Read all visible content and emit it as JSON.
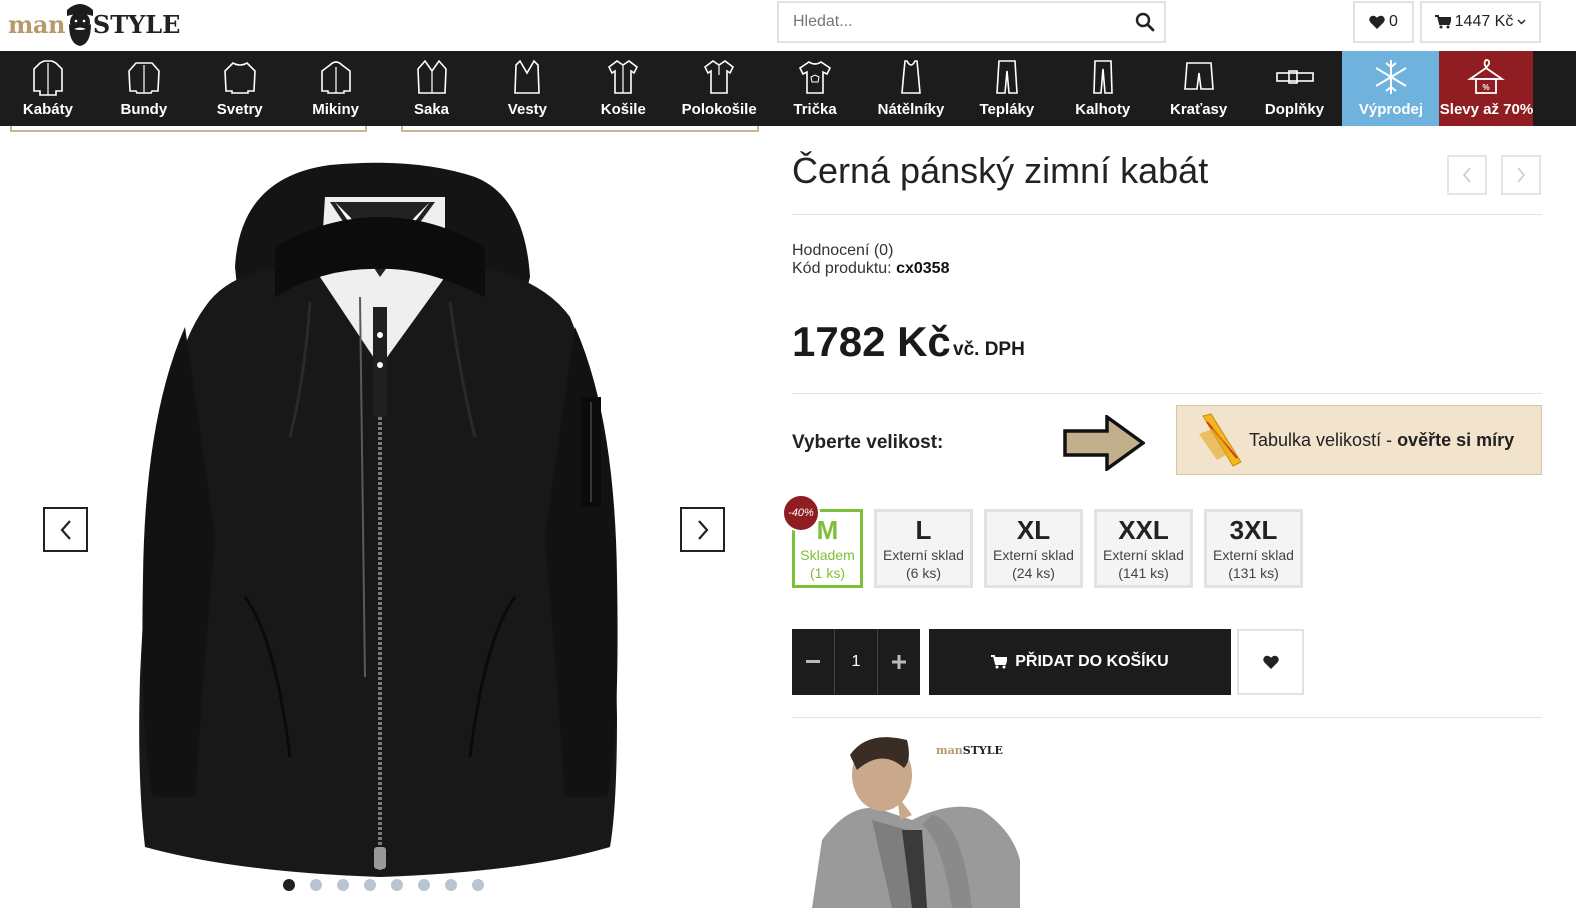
{
  "header": {
    "logo_left": "man",
    "logo_right": "STYLE",
    "search_placeholder": "Hledat...",
    "wishlist_count": "0",
    "cart_total": "1447 Kč"
  },
  "nav": {
    "items": [
      {
        "label": "Kabáty",
        "icon": "coat-icon"
      },
      {
        "label": "Bundy",
        "icon": "jacket-icon"
      },
      {
        "label": "Svetry",
        "icon": "sweater-icon"
      },
      {
        "label": "Mikiny",
        "icon": "hoodie-icon"
      },
      {
        "label": "Saka",
        "icon": "blazer-icon"
      },
      {
        "label": "Vesty",
        "icon": "vest-icon"
      },
      {
        "label": "Košile",
        "icon": "shirt-icon"
      },
      {
        "label": "Polokošile",
        "icon": "polo-icon"
      },
      {
        "label": "Trička",
        "icon": "tshirt-icon"
      },
      {
        "label": "Nátělníky",
        "icon": "tanktop-icon"
      },
      {
        "label": "Tepláky",
        "icon": "sweatpants-icon"
      },
      {
        "label": "Kalhoty",
        "icon": "trousers-icon"
      },
      {
        "label": "Kraťasy",
        "icon": "shorts-icon"
      },
      {
        "label": "Doplňky",
        "icon": "belt-icon"
      },
      {
        "label": "Výprodej",
        "icon": "snowflake-icon"
      },
      {
        "label": "Slevy až 70%",
        "icon": "hanger-icon"
      }
    ],
    "sale_color": "#6fb2dd",
    "discount_color": "#8f1d21"
  },
  "product": {
    "title": "Černá pánský zimní kabát",
    "rating_label": "Hodnocení (0)",
    "code_label": "Kód produktu: ",
    "code": "cx0358",
    "price": "1782 Kč",
    "vat": "vč. DPH",
    "size_label": "Vyberte velikost:",
    "size_table_text": "Tabulka velikostí - ",
    "size_table_bold": "ověřte si míry",
    "sizes": [
      {
        "size": "M",
        "status": "Skladem",
        "count": "(1 ks)",
        "badge": "-40%"
      },
      {
        "size": "L",
        "status": "Externí sklad",
        "count": "(6 ks)"
      },
      {
        "size": "XL",
        "status": "Externí sklad",
        "count": "(24 ks)"
      },
      {
        "size": "XXL",
        "status": "Externí sklad",
        "count": "(141 ks)"
      },
      {
        "size": "3XL",
        "status": "Externí sklad",
        "count": "(131 ks)"
      }
    ],
    "quantity": "1",
    "add_to_cart": "PŘIDAT DO KOŠÍKU",
    "accent_color": "#7dbf37"
  },
  "gallery": {
    "dots_count": 8,
    "active_dot": 1
  },
  "banner": {
    "logo_left": "man",
    "logo_right": "STYLE"
  }
}
